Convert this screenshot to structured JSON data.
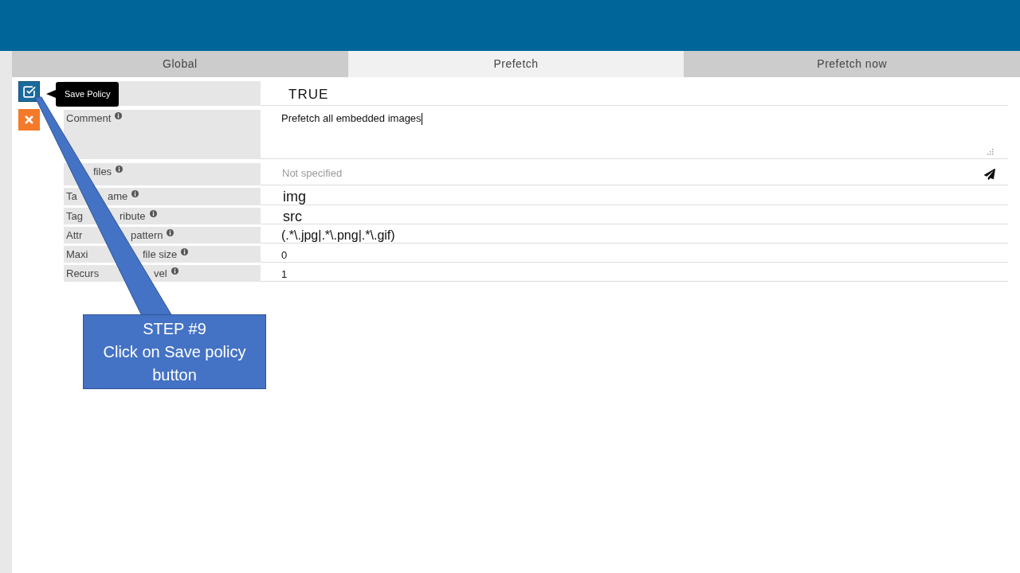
{
  "tabs": [
    {
      "label": "Global",
      "selected": false
    },
    {
      "label": "Prefetch",
      "selected": true
    },
    {
      "label": "Prefetch now",
      "selected": false
    }
  ],
  "save_tooltip": "Save Policy",
  "fields": [
    {
      "kind": "value",
      "value": "TRUE"
    },
    {
      "kind": "textarea",
      "label_start": "Comment",
      "info": true,
      "value": "Prefetch all embedded images",
      "focused": true
    },
    {
      "kind": "input_send",
      "label_end": "files",
      "info": true,
      "placeholder": "Not specified"
    },
    {
      "kind": "value",
      "label_start": "Ta",
      "label_end": "ame",
      "info": true,
      "value": "img"
    },
    {
      "kind": "value",
      "label_start": "Tag",
      "label_end": "ribute",
      "info": true,
      "value": "src"
    },
    {
      "kind": "value",
      "label_start": "Attr",
      "label_end": "pattern",
      "info": true,
      "value": "(.*\\.jpg|.*\\.png|.*\\.gif)"
    },
    {
      "kind": "value",
      "label_start": "Maxi",
      "label_end": "file size",
      "info": true,
      "value": "0"
    },
    {
      "kind": "value",
      "label_start": "Recurs",
      "label_end": "vel",
      "info": true,
      "value": "1"
    }
  ],
  "callout": {
    "title": "STEP #9",
    "text": "Click on Save policy button"
  }
}
